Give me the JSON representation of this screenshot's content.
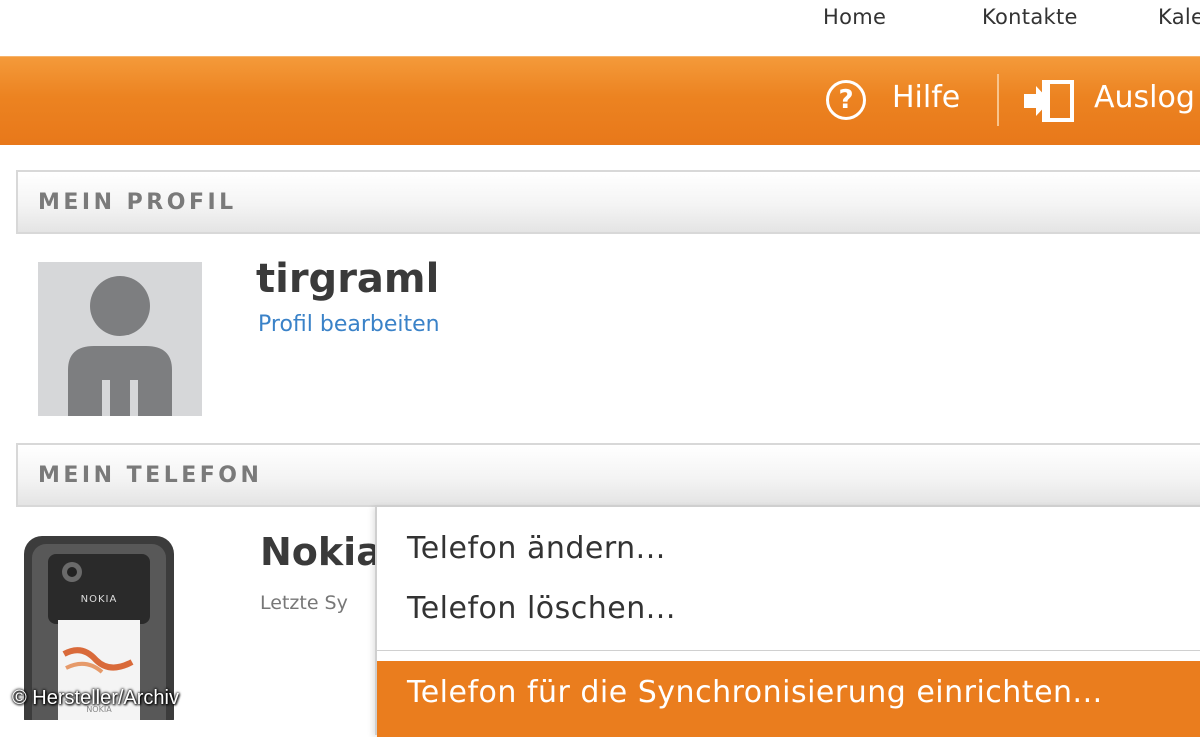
{
  "topnav": {
    "items": [
      {
        "label": "Home"
      },
      {
        "label": "Kontakte"
      },
      {
        "label": "Kale"
      }
    ]
  },
  "toolbar": {
    "help_label": "Hilfe",
    "logout_label": "Auslog",
    "help_icon": "?"
  },
  "profile": {
    "section_title": "MEIN PROFIL",
    "username": "tirgraml",
    "edit_link": "Profil bearbeiten"
  },
  "phone": {
    "section_title": "MEIN TELEFON",
    "name": "Nokia",
    "last_sync": "Letzte Sy"
  },
  "context_menu": {
    "items": [
      {
        "label": "Telefon ändern..."
      },
      {
        "label": "Telefon löschen..."
      },
      {
        "label": "Telefon für die Synchronisierung einrichten..."
      }
    ]
  },
  "copyright": "© Hersteller/Archiv",
  "colors": {
    "accent_orange": "#ec8321",
    "link_blue": "#3a82c8"
  }
}
